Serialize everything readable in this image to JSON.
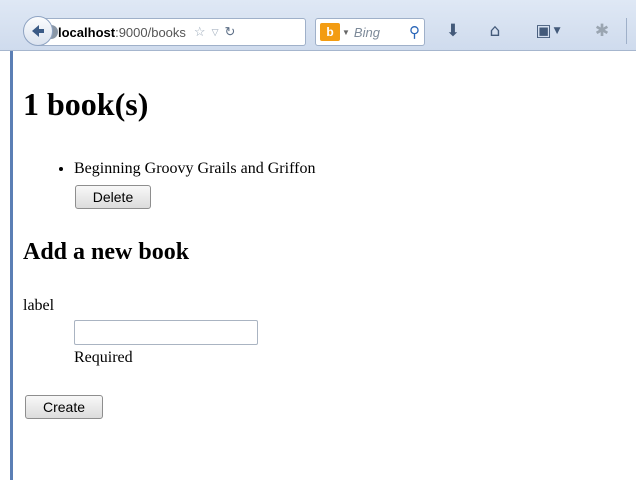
{
  "browser": {
    "url_host": "localhost",
    "url_path": ":9000/books",
    "search_placeholder": "Bing"
  },
  "books_section": {
    "heading": "1 book(s)",
    "items": [
      {
        "title": "Beginning Groovy Grails and Griffon",
        "delete_label": "Delete"
      }
    ]
  },
  "add_section": {
    "heading": "Add a new book",
    "field_label": "label",
    "field_value": "",
    "field_hint": "Required",
    "create_label": "Create"
  }
}
